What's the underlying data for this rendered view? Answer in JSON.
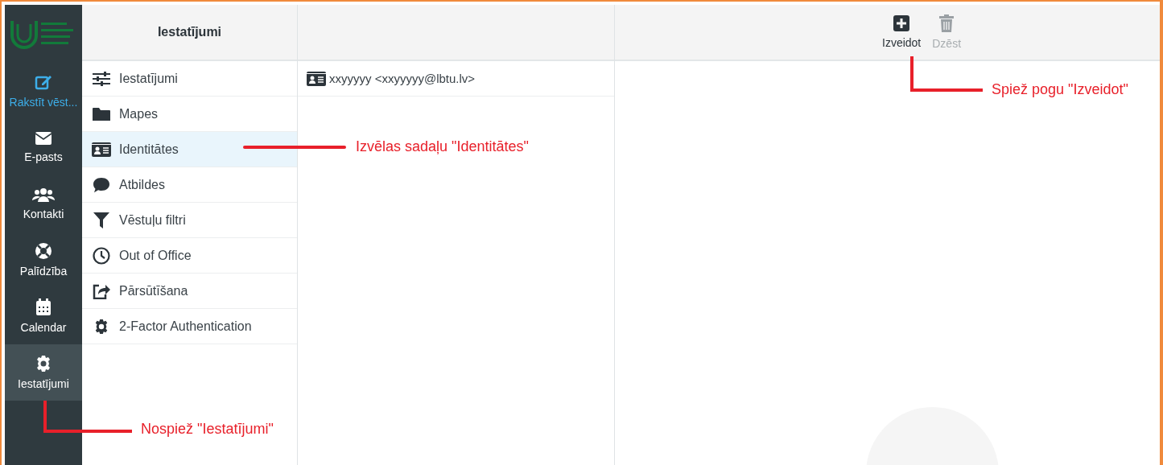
{
  "nav": [
    {
      "label": "Rakstīt vēst...",
      "kind": "compose",
      "selected": false
    },
    {
      "label": "E-pasts",
      "kind": "mail",
      "selected": false
    },
    {
      "label": "Kontakti",
      "kind": "contacts",
      "selected": false
    },
    {
      "label": "Palīdzība",
      "kind": "help",
      "selected": false
    },
    {
      "label": "Calendar",
      "kind": "calendar",
      "selected": false
    },
    {
      "label": "Iestatījumi",
      "kind": "settings",
      "selected": true
    }
  ],
  "settings": {
    "title": "Iestatījumi",
    "items": [
      {
        "label": "Iestatījumi",
        "selected": false
      },
      {
        "label": "Mapes",
        "selected": false
      },
      {
        "label": "Identitātes",
        "selected": true
      },
      {
        "label": "Atbildes",
        "selected": false
      },
      {
        "label": "Vēstuļu filtri",
        "selected": false
      },
      {
        "label": "Out of Office",
        "selected": false
      },
      {
        "label": "Pārsūtīšana",
        "selected": false
      },
      {
        "label": "2-Factor Authentication",
        "selected": false
      }
    ]
  },
  "identities": [
    {
      "label": "xxyyyyy <xxyyyyy@lbtu.lv>"
    }
  ],
  "toolbar": [
    {
      "label": "Izveidot",
      "kind": "create",
      "disabled": false
    },
    {
      "label": "Dzēst",
      "kind": "delete",
      "disabled": true
    }
  ],
  "annotations": [
    {
      "text": "Izvēlas sadaļu \"Identitātes\""
    },
    {
      "text": "Spiež pogu \"Izveidot\""
    },
    {
      "text": "Nospiež \"Iestatījumi\""
    }
  ]
}
